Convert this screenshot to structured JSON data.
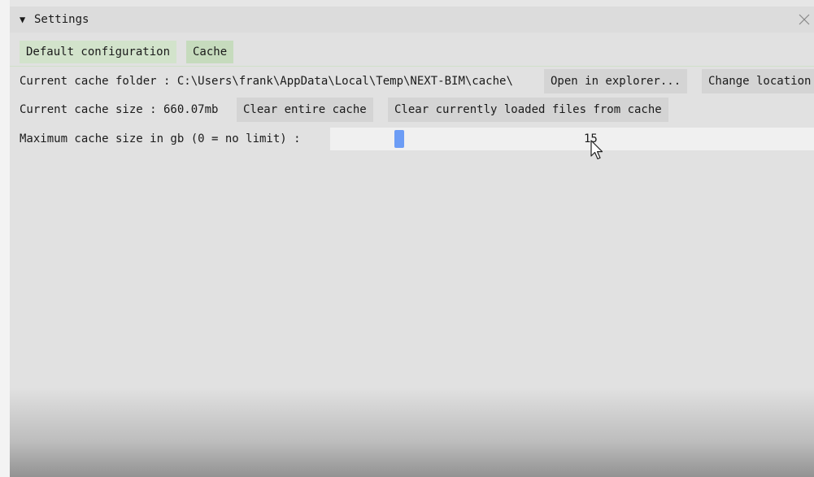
{
  "window": {
    "title": "Settings",
    "collapse_glyph": "▼",
    "close_glyph": "✕"
  },
  "tabs": [
    {
      "label": "Default configuration",
      "active": false
    },
    {
      "label": "Cache",
      "active": true
    }
  ],
  "cache": {
    "folder_label": "Current cache folder : C:\\Users\\frank\\AppData\\Local\\Temp\\NEXT-BIM\\cache\\",
    "open_button": "Open in explorer...",
    "change_button": "Change location",
    "size_label": "Current cache size : 660.07mb",
    "clear_all_button": "Clear entire cache",
    "clear_loaded_button": "Clear currently loaded files from cache",
    "max_label": "Maximum cache size in gb (0 = no limit) :",
    "max_value": "15",
    "slider_fraction": 0.135
  },
  "colors": {
    "accent": "#6c9cf5",
    "tab": "#d2e3cb",
    "background": "#e1e1e1"
  },
  "icons": {
    "close": "close-icon",
    "collapse": "triangle-down-icon",
    "cursor": "mouse-pointer-icon"
  }
}
